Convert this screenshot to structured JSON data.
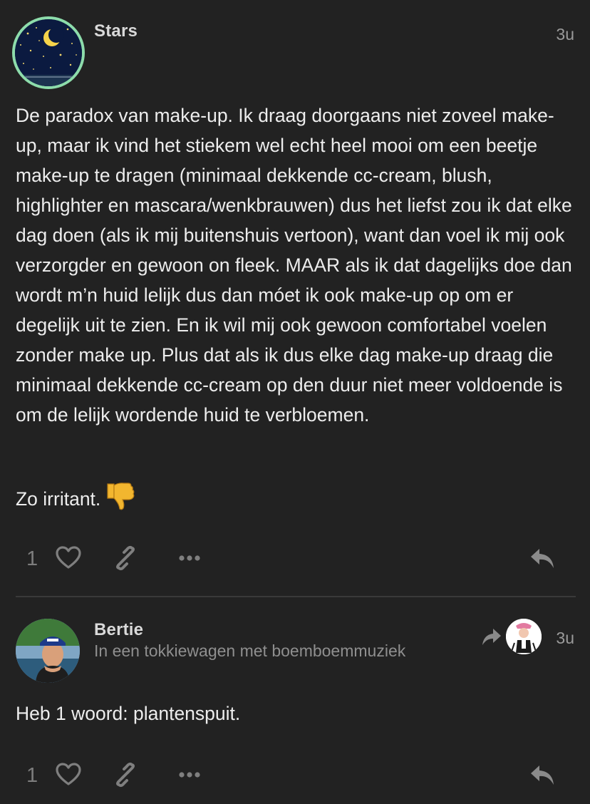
{
  "posts": [
    {
      "username": "Stars",
      "age": "3u",
      "paragraphs": [
        "De paradox van make-up. Ik draag doorgaans niet zoveel make-up, maar ik vind het stiekem wel echt heel mooi om een beetje make-up te dragen (minimaal dekkende cc-cream, blush, highlighter en mascara/wenkbrauwen) dus het liefst zou ik dat elke dag doen (als ik mij buitenshuis vertoon), want dan voel ik mij ook verzorgder en gewoon on fleek. MAAR als ik dat dagelijks doe dan wordt m’n huid lelijk dus dan móet ik ook make-up op om er degelijk uit te zien. En ik wil mij ook gewoon comfortabel voelen zonder make up. Plus dat als ik dus elke dag make-up draag die minimaal dekkende cc-cream op den duur niet meer voldoende is om de lelijk wordende huid te verbloemen.",
        "Zo irritant."
      ],
      "emoji": "thumbs-down",
      "like_count": "1"
    },
    {
      "username": "Bertie",
      "subtitle": "In een tokkiewagen met boemboemmuziek",
      "age": "3u",
      "paragraphs": [
        "Heb 1 woord: plantenspuit."
      ],
      "like_count": "1"
    }
  ],
  "icons": {
    "like": "heart-icon",
    "share": "link-icon",
    "more": "ellipsis-icon",
    "reply": "reply-icon",
    "reply_to": "share-arrow-icon"
  },
  "colors": {
    "background": "#222222",
    "text": "#ededed",
    "muted": "#8f8f8f",
    "avatar_ring": "#8ddcab",
    "emoji": "#f2b62f"
  }
}
